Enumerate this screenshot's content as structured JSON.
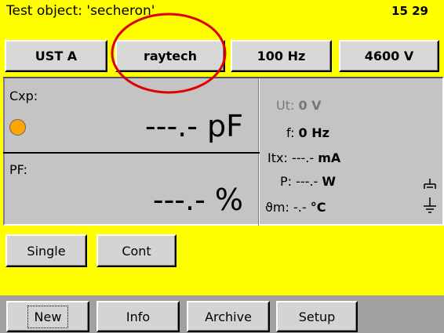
{
  "header": {
    "title": "Test object: 'secheron'",
    "time": "15 29"
  },
  "settings": {
    "mode": "UST A",
    "instrument": "raytech",
    "frequency": "100 Hz",
    "voltage": "4600 V"
  },
  "measurement": {
    "cxp_label": "Cxp:",
    "cxp_value": "---.- pF",
    "pf_label": "PF:",
    "pf_value": "---.- %",
    "ut_label": "Ut:",
    "ut_value": "0 V",
    "f_label": "f:",
    "f_value": "0 Hz",
    "itx_label": "Itx: ---.-",
    "itx_unit": "mA",
    "p_label": "P: ---.-",
    "p_unit": "W",
    "theta_label": "ϑm: -.-",
    "theta_unit": "°C"
  },
  "actions": {
    "single": "Single",
    "cont": "Cont"
  },
  "tabs": {
    "new": "New",
    "info": "Info",
    "archive": "Archive",
    "setup": "Setup"
  },
  "colors": {
    "background": "#ffff00",
    "indicator": "#ffa500",
    "annotation": "#e00000"
  }
}
